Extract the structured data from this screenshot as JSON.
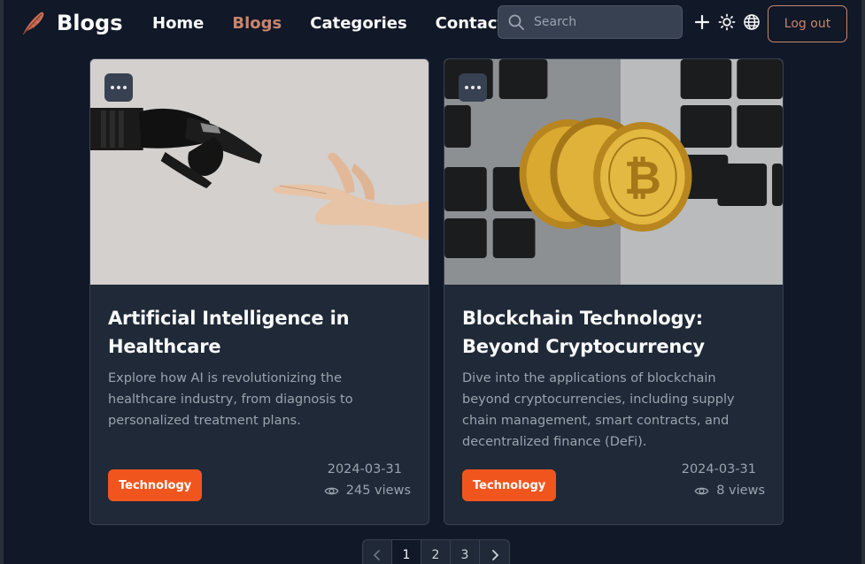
{
  "brand": {
    "name": "Blogs"
  },
  "nav": [
    {
      "label": "Home",
      "active": false
    },
    {
      "label": "Blogs",
      "active": true
    },
    {
      "label": "Categories",
      "active": false
    },
    {
      "label": "Contact",
      "active": false
    }
  ],
  "search": {
    "placeholder": "Search",
    "value": ""
  },
  "header_icons": [
    "plus-icon",
    "sun-icon",
    "globe-icon"
  ],
  "auth": {
    "logout_label": "Log out"
  },
  "posts": [
    {
      "title": "Artificial Intelligence in Healthcare",
      "description": "Explore how AI is revolutionizing the healthcare industry, from diagnosis to personalized treatment plans.",
      "category": "Technology",
      "date": "2024-03-31",
      "views": "245 views"
    },
    {
      "title": "Blockchain Technology: Beyond Cryptocurrency",
      "description": "Dive into the applications of blockchain beyond cryptocurrencies, including supply chain management, smart contracts, and decentralized finance (DeFi).",
      "category": "Technology",
      "date": "2024-03-31",
      "views": "8 views"
    }
  ],
  "pagination": {
    "pages": [
      "1",
      "2",
      "3"
    ],
    "current": "1"
  },
  "colors": {
    "background": "#111827",
    "card": "#1f2937",
    "accent": "#c9856d",
    "tag": "#f1551e"
  }
}
